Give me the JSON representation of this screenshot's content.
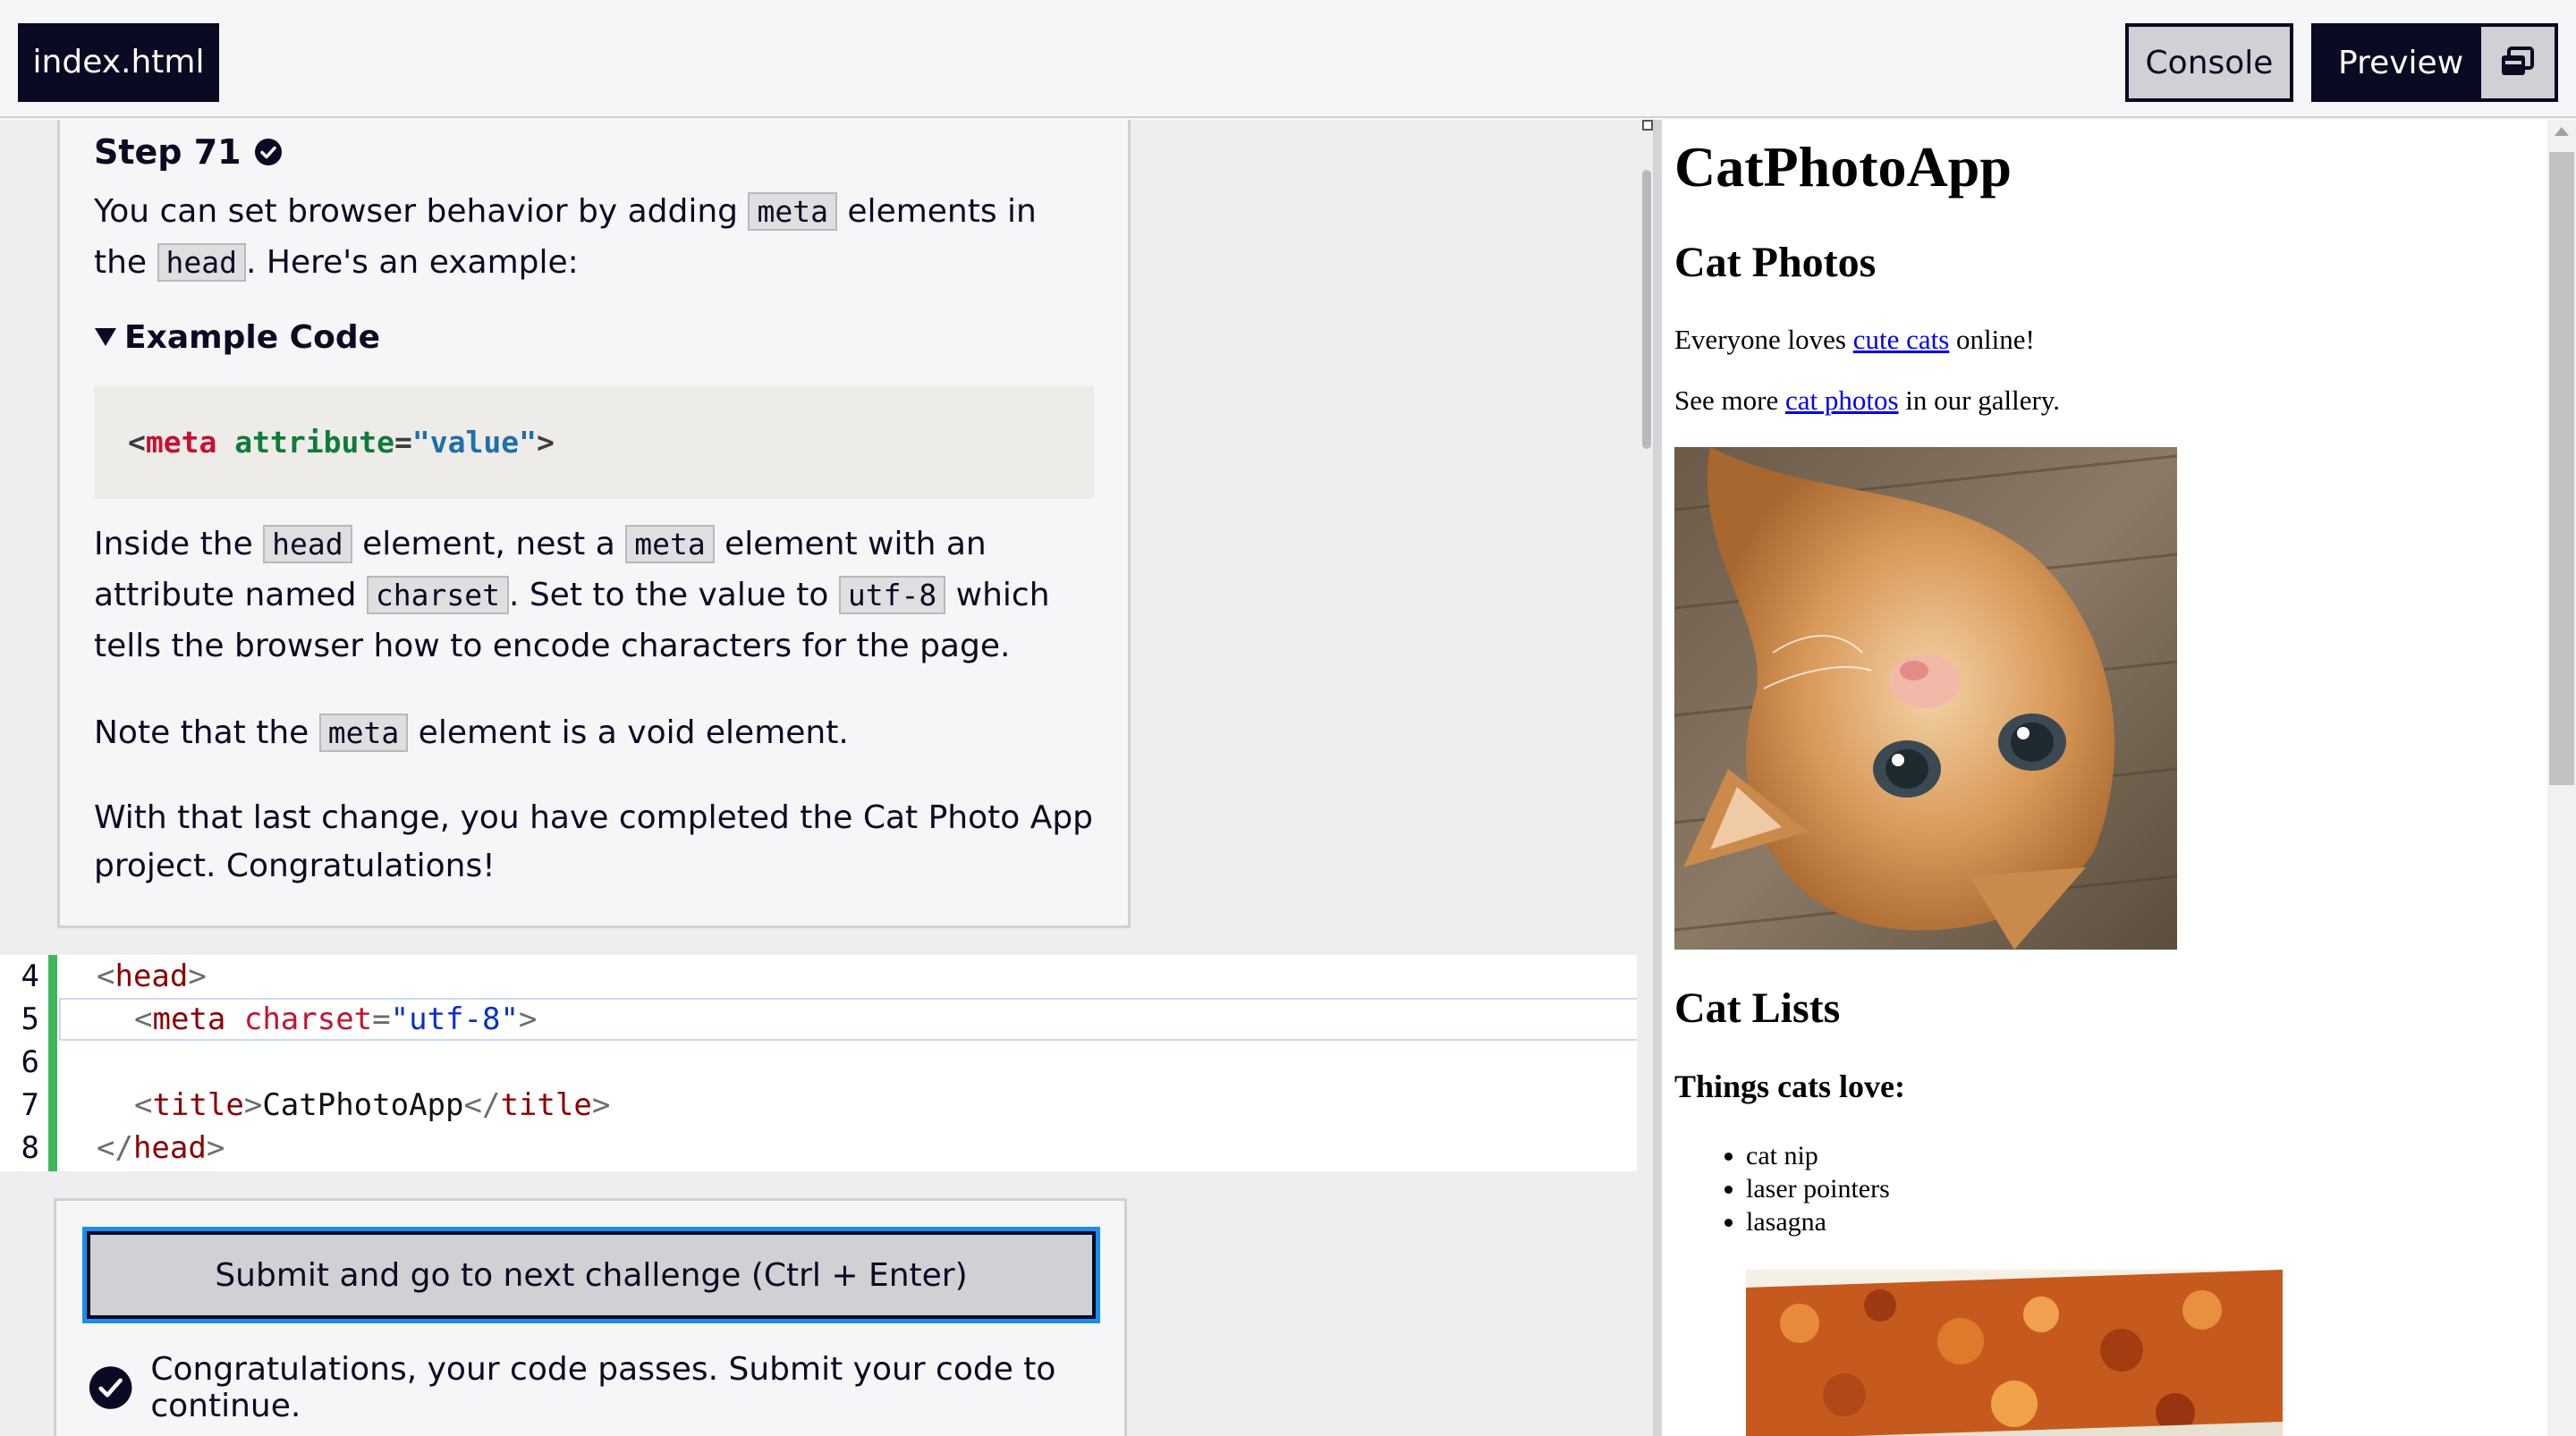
{
  "topbar": {
    "file_tab": "index.html",
    "console_label": "Console",
    "preview_label": "Preview"
  },
  "instructions": {
    "step_title": "Step 71",
    "p1": [
      "You can set browser behavior by adding ",
      "meta",
      " elements in the ",
      "head",
      ". Here's an example:"
    ],
    "example_summary": "Example Code",
    "example_code": {
      "open": "<",
      "tag": "meta",
      "attr": "attribute",
      "eq": "=",
      "val": "\"value\"",
      "close": ">"
    },
    "p2": [
      "Inside the ",
      "head",
      " element, nest a ",
      "meta",
      " element with an attribute named ",
      "charset",
      ". Set to the value to ",
      "utf-8",
      " which tells the browser how to encode characters for the page."
    ],
    "p3": [
      "Note that the ",
      "meta",
      " element is a void element."
    ],
    "p4": "With that last change, you have completed the Cat Photo App project. Congratulations!"
  },
  "editor": {
    "line_numbers": [
      "4",
      "5",
      "6",
      "7",
      "8"
    ],
    "line4": {
      "lt": "<",
      "tag": "head",
      "gt": ">"
    },
    "line5": {
      "lt": "<",
      "tag": "meta",
      "attr": " charset",
      "eq": "=",
      "val": "\"utf-8\"",
      "gt": ">"
    },
    "line7": {
      "lt": "<",
      "tag": "title",
      "gt": ">",
      "text": "CatPhotoApp",
      "lt2": "</",
      "tag2": "title",
      "gt2": ">"
    },
    "line8": {
      "lt": "</",
      "tag": "head",
      "gt": ">"
    }
  },
  "submit": {
    "button_label": "Submit and go to next challenge (Ctrl + Enter)",
    "pass_message": "Congratulations, your code passes. Submit your code to continue."
  },
  "preview": {
    "h1": "CatPhotoApp",
    "h2_photos": "Cat Photos",
    "p1_before": "Everyone loves ",
    "p1_link": "cute cats",
    "p1_after": " online!",
    "p2_before": "See more ",
    "p2_link": "cat photos",
    "p2_after": " in our gallery.",
    "h2_lists": "Cat Lists",
    "h3_love": "Things cats love:",
    "love_items": [
      "cat nip",
      "laser pointers",
      "lasagna"
    ]
  },
  "colors": {
    "brand_dark": "#0a0a23",
    "focus_blue": "#198eee",
    "gutter_green": "#3eb85a"
  }
}
